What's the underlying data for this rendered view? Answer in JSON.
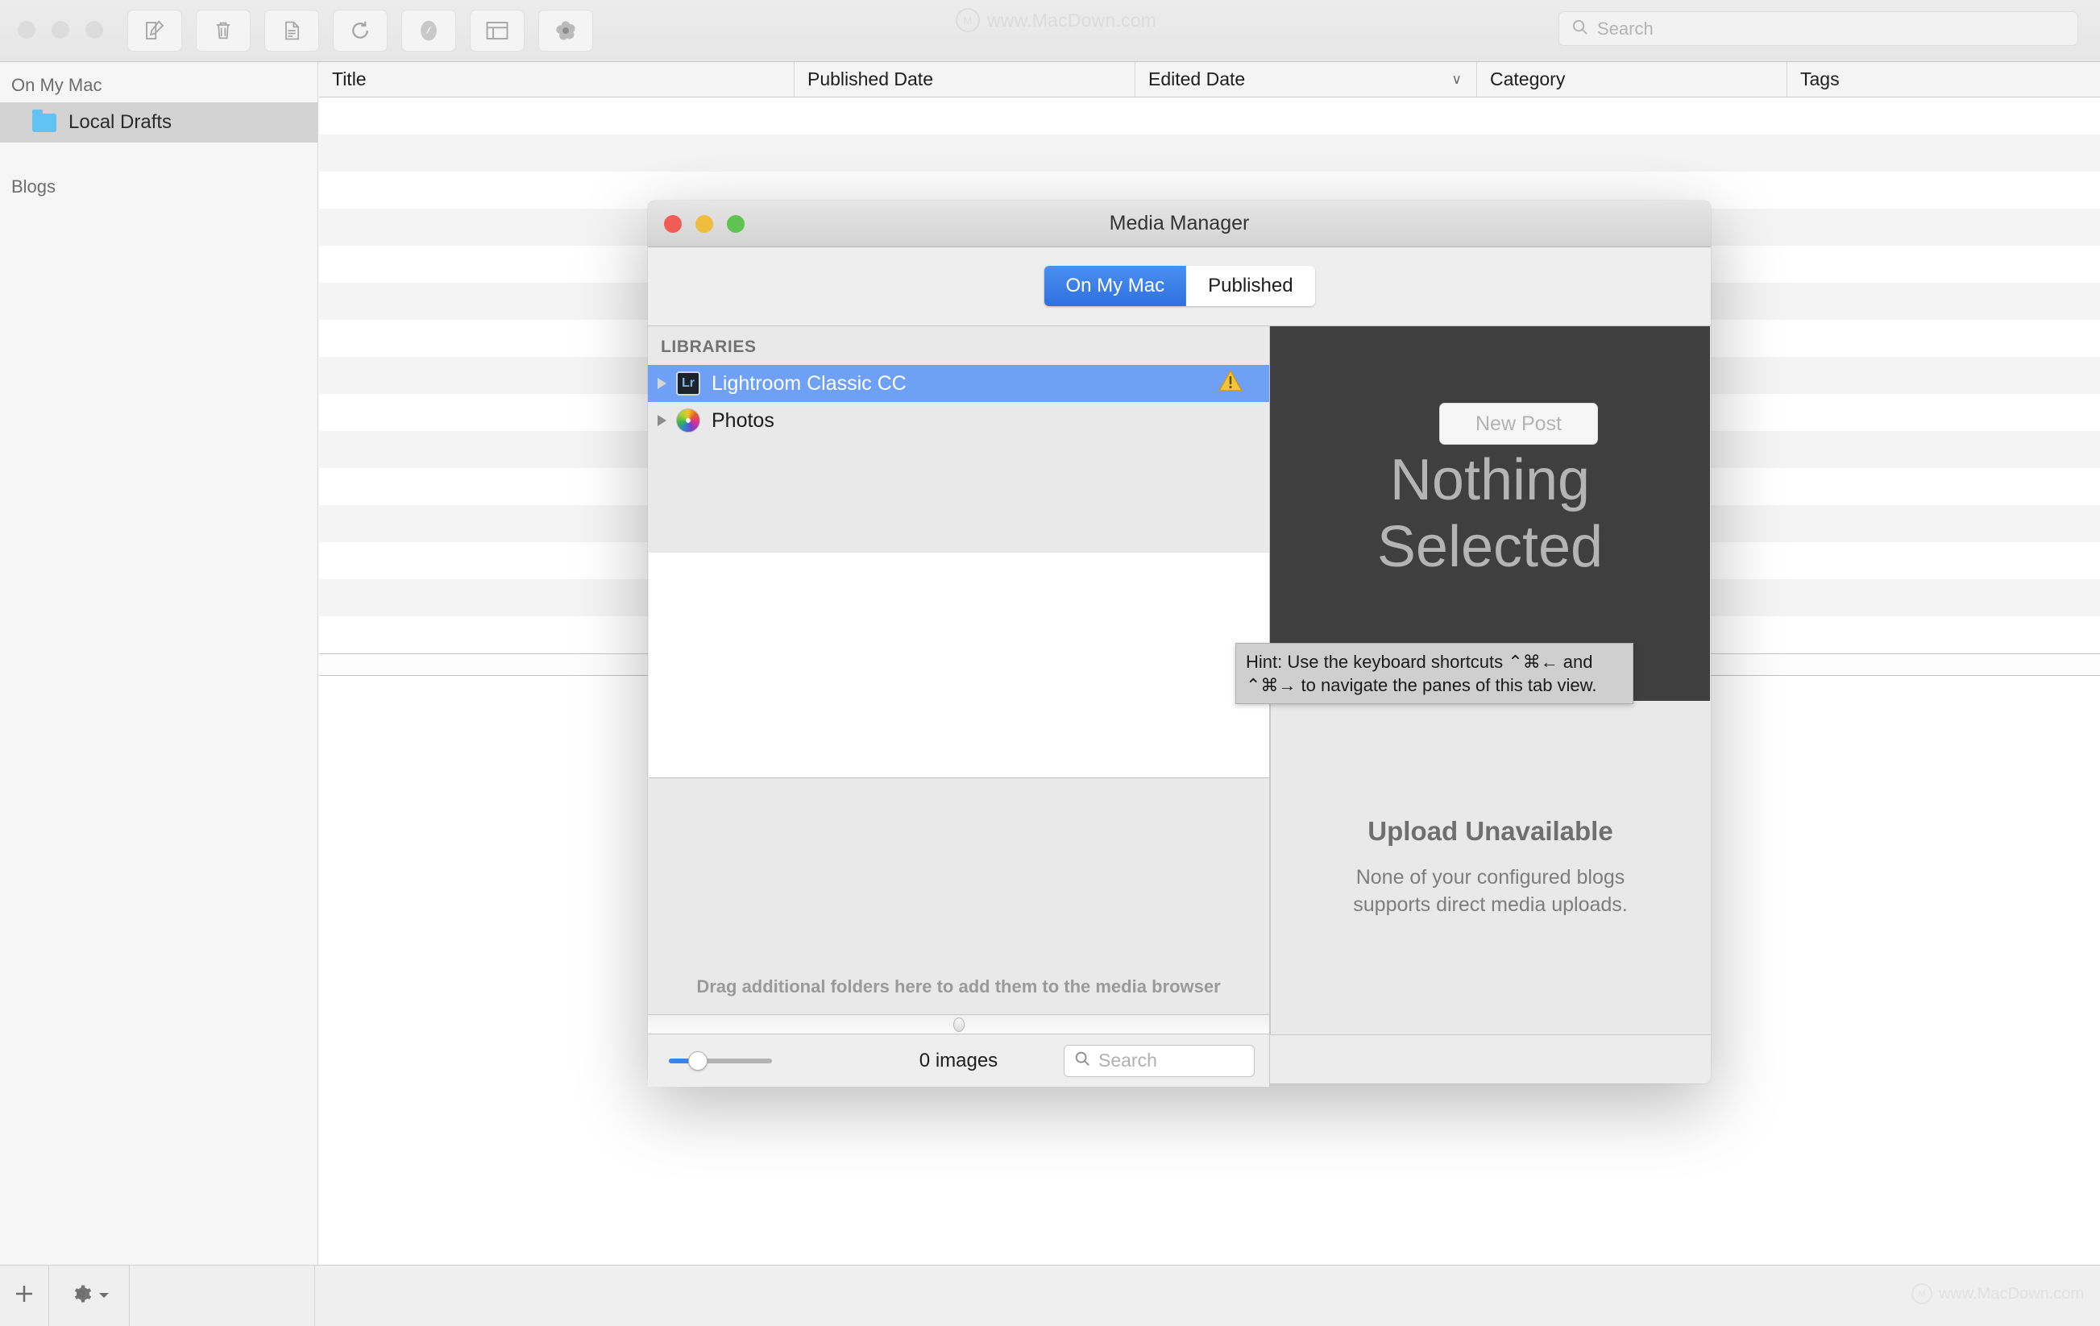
{
  "app": {
    "watermark": "www.MacDown.com",
    "toolbar": {
      "buttons": [
        {
          "name": "new-post-icon",
          "label": "New Post"
        },
        {
          "name": "delete-icon",
          "label": "Delete"
        },
        {
          "name": "duplicate-icon",
          "label": "Duplicate"
        },
        {
          "name": "refresh-icon",
          "label": "Refresh"
        },
        {
          "name": "preview-icon",
          "label": "Preview"
        },
        {
          "name": "layout-icon",
          "label": "Layout"
        },
        {
          "name": "media-icon",
          "label": "Media"
        }
      ],
      "search_placeholder": "Search"
    },
    "sidebar": {
      "sections": [
        {
          "header": "On My Mac",
          "items": [
            {
              "label": "Local Drafts",
              "selected": true,
              "icon": "folder-icon"
            }
          ]
        },
        {
          "header": "Blogs",
          "items": []
        }
      ]
    },
    "table": {
      "columns": [
        "Title",
        "Published Date",
        "Edited Date",
        "Category",
        "Tags"
      ],
      "sorted_column": "Edited Date",
      "sort_indicator": "∨",
      "rows": []
    },
    "bottom_bar": {
      "add_label": "+",
      "gear_label": "Settings",
      "watermark": "www.MacDown.com"
    }
  },
  "dialog": {
    "title": "Media Manager",
    "tabs": [
      {
        "label": "On My Mac",
        "active": true
      },
      {
        "label": "Published",
        "active": false
      }
    ],
    "libraries": {
      "header": "LIBRARIES",
      "items": [
        {
          "label": "Lightroom Classic CC",
          "selected": true,
          "icon": "lightroom-icon",
          "badge": "warning-icon"
        },
        {
          "label": "Photos",
          "selected": false,
          "icon": "photos-icon",
          "badge": ""
        }
      ],
      "drag_hint": "Drag additional folders here to add them to the media browser"
    },
    "preview": {
      "empty_line1": "Nothing",
      "empty_line2": "Selected"
    },
    "upload": {
      "title": "Upload Unavailable",
      "message_line1": "None of your configured blogs",
      "message_line2": "supports direct media uploads."
    },
    "footer": {
      "image_count": "0 images",
      "search_placeholder": "Search",
      "new_post_label": "New Post"
    },
    "tooltip": {
      "line1": "Hint: Use the keyboard shortcuts ⌃⌘← and",
      "line2": "⌃⌘→ to navigate the panes of this tab view."
    }
  }
}
